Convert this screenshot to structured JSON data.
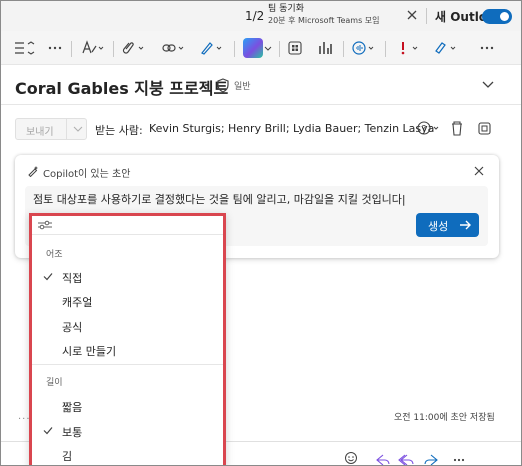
{
  "topbar": {
    "page_count": "1/2",
    "notification_title": "팀 동기화",
    "notification_subtitle": "20분 후 Microsoft Teams 모임",
    "new_outlook_label": "새 Outlook",
    "new_outlook_toggle_on": true
  },
  "toolbar": {
    "icons": [
      "format-icon",
      "more-icon",
      "styles-icon",
      "attach-icon",
      "link-icon",
      "signature-icon",
      "copilot-icon",
      "apps-icon",
      "chart-icon",
      "voice-icon",
      "importance-icon",
      "paint-icon",
      "more-icon"
    ]
  },
  "message": {
    "subject": "Coral Gables 지붕 프로젝트",
    "sensitivity": "일반",
    "send_label": "보내기",
    "to_label": "받는 사람:",
    "recipients": "Kevin Sturgis; Henry Brill; Lydia Bauer; Tenzin Lasya"
  },
  "copilot": {
    "title": "Copilot이 있는 초안",
    "prompt": "점토 대상포를 사용하기로 결정했다는 것을 팀에 알리고, 마감일을 지킬 것입니다|",
    "generate_label": "생성",
    "accent": "#0f6cbd"
  },
  "options_menu": {
    "tone_heading": "어조",
    "tone_options": [
      {
        "label": "직접",
        "checked": true
      },
      {
        "label": "캐주얼",
        "checked": false
      },
      {
        "label": "공식",
        "checked": false
      },
      {
        "label": "시로 만들기",
        "checked": false
      }
    ],
    "length_heading": "길이",
    "length_options": [
      {
        "label": "짧음",
        "checked": false
      },
      {
        "label": "보통",
        "checked": true
      },
      {
        "label": "김",
        "checked": false
      }
    ],
    "highlight_color": "#d9464f"
  },
  "status": {
    "dots": "...",
    "draft_saved": "오전 11:00에 초안 저장됨"
  }
}
